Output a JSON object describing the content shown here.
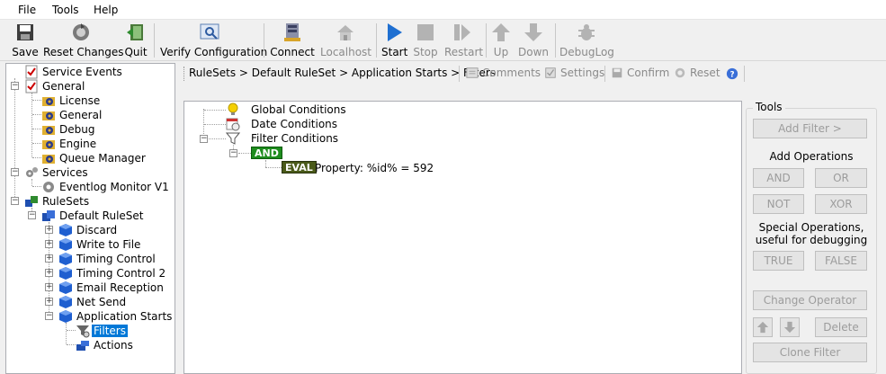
{
  "menu": {
    "file": "File",
    "tools": "Tools",
    "help": "Help"
  },
  "toolbar": {
    "save": "Save",
    "reset_changes": "Reset Changes",
    "quit": "Quit",
    "verify_configuration": "Verify Configuration",
    "connect": "Connect",
    "localhost": "Localhost",
    "start": "Start",
    "stop": "Stop",
    "restart": "Restart",
    "up": "Up",
    "down": "Down",
    "debuglog": "DebugLog"
  },
  "left_tree": {
    "service_events": "Service Events",
    "general": "General",
    "license": "License",
    "general_child": "General",
    "debug": "Debug",
    "engine": "Engine",
    "queue_manager": "Queue Manager",
    "services": "Services",
    "eventlog_monitor": "Eventlog Monitor V1",
    "rulesets": "RuleSets",
    "default_ruleset": "Default RuleSet",
    "discard": "Discard",
    "write_to_file": "Write to File",
    "timing_control": "Timing Control",
    "timing_control_2": "Timing Control 2",
    "email_reception": "Email Reception",
    "net_send": "Net Send",
    "application_starts": "Application Starts",
    "filters": "Filters",
    "actions": "Actions"
  },
  "breadcrumb": "RuleSets > Default RuleSet > Application Starts > Filters",
  "content_toolbar": {
    "comments": "Comments",
    "settings": "Settings",
    "confirm": "Confirm",
    "reset": "Reset"
  },
  "filter_tree": {
    "global_conditions": "Global Conditions",
    "date_conditions": "Date Conditions",
    "filter_conditions": "Filter Conditions",
    "and_badge": "AND",
    "eval_badge": "EVAL",
    "eval_text": "Property: %id% = 592"
  },
  "tools_panel": {
    "title": "Tools",
    "add_filter": "Add Filter >",
    "add_operations": "Add Operations",
    "and": "AND",
    "or": "OR",
    "not": "NOT",
    "xor": "XOR",
    "special_line1": "Special Operations,",
    "special_line2": "useful for debugging",
    "true": "TRUE",
    "false": "FALSE",
    "change_operator": "Change Operator",
    "delete": "Delete",
    "clone_filter": "Clone Filter"
  },
  "colors": {
    "selection": "#0078d7",
    "and_badge": "#1e8c1e",
    "eval_badge": "#4a5a1a",
    "start_icon": "#1f6fd1"
  }
}
